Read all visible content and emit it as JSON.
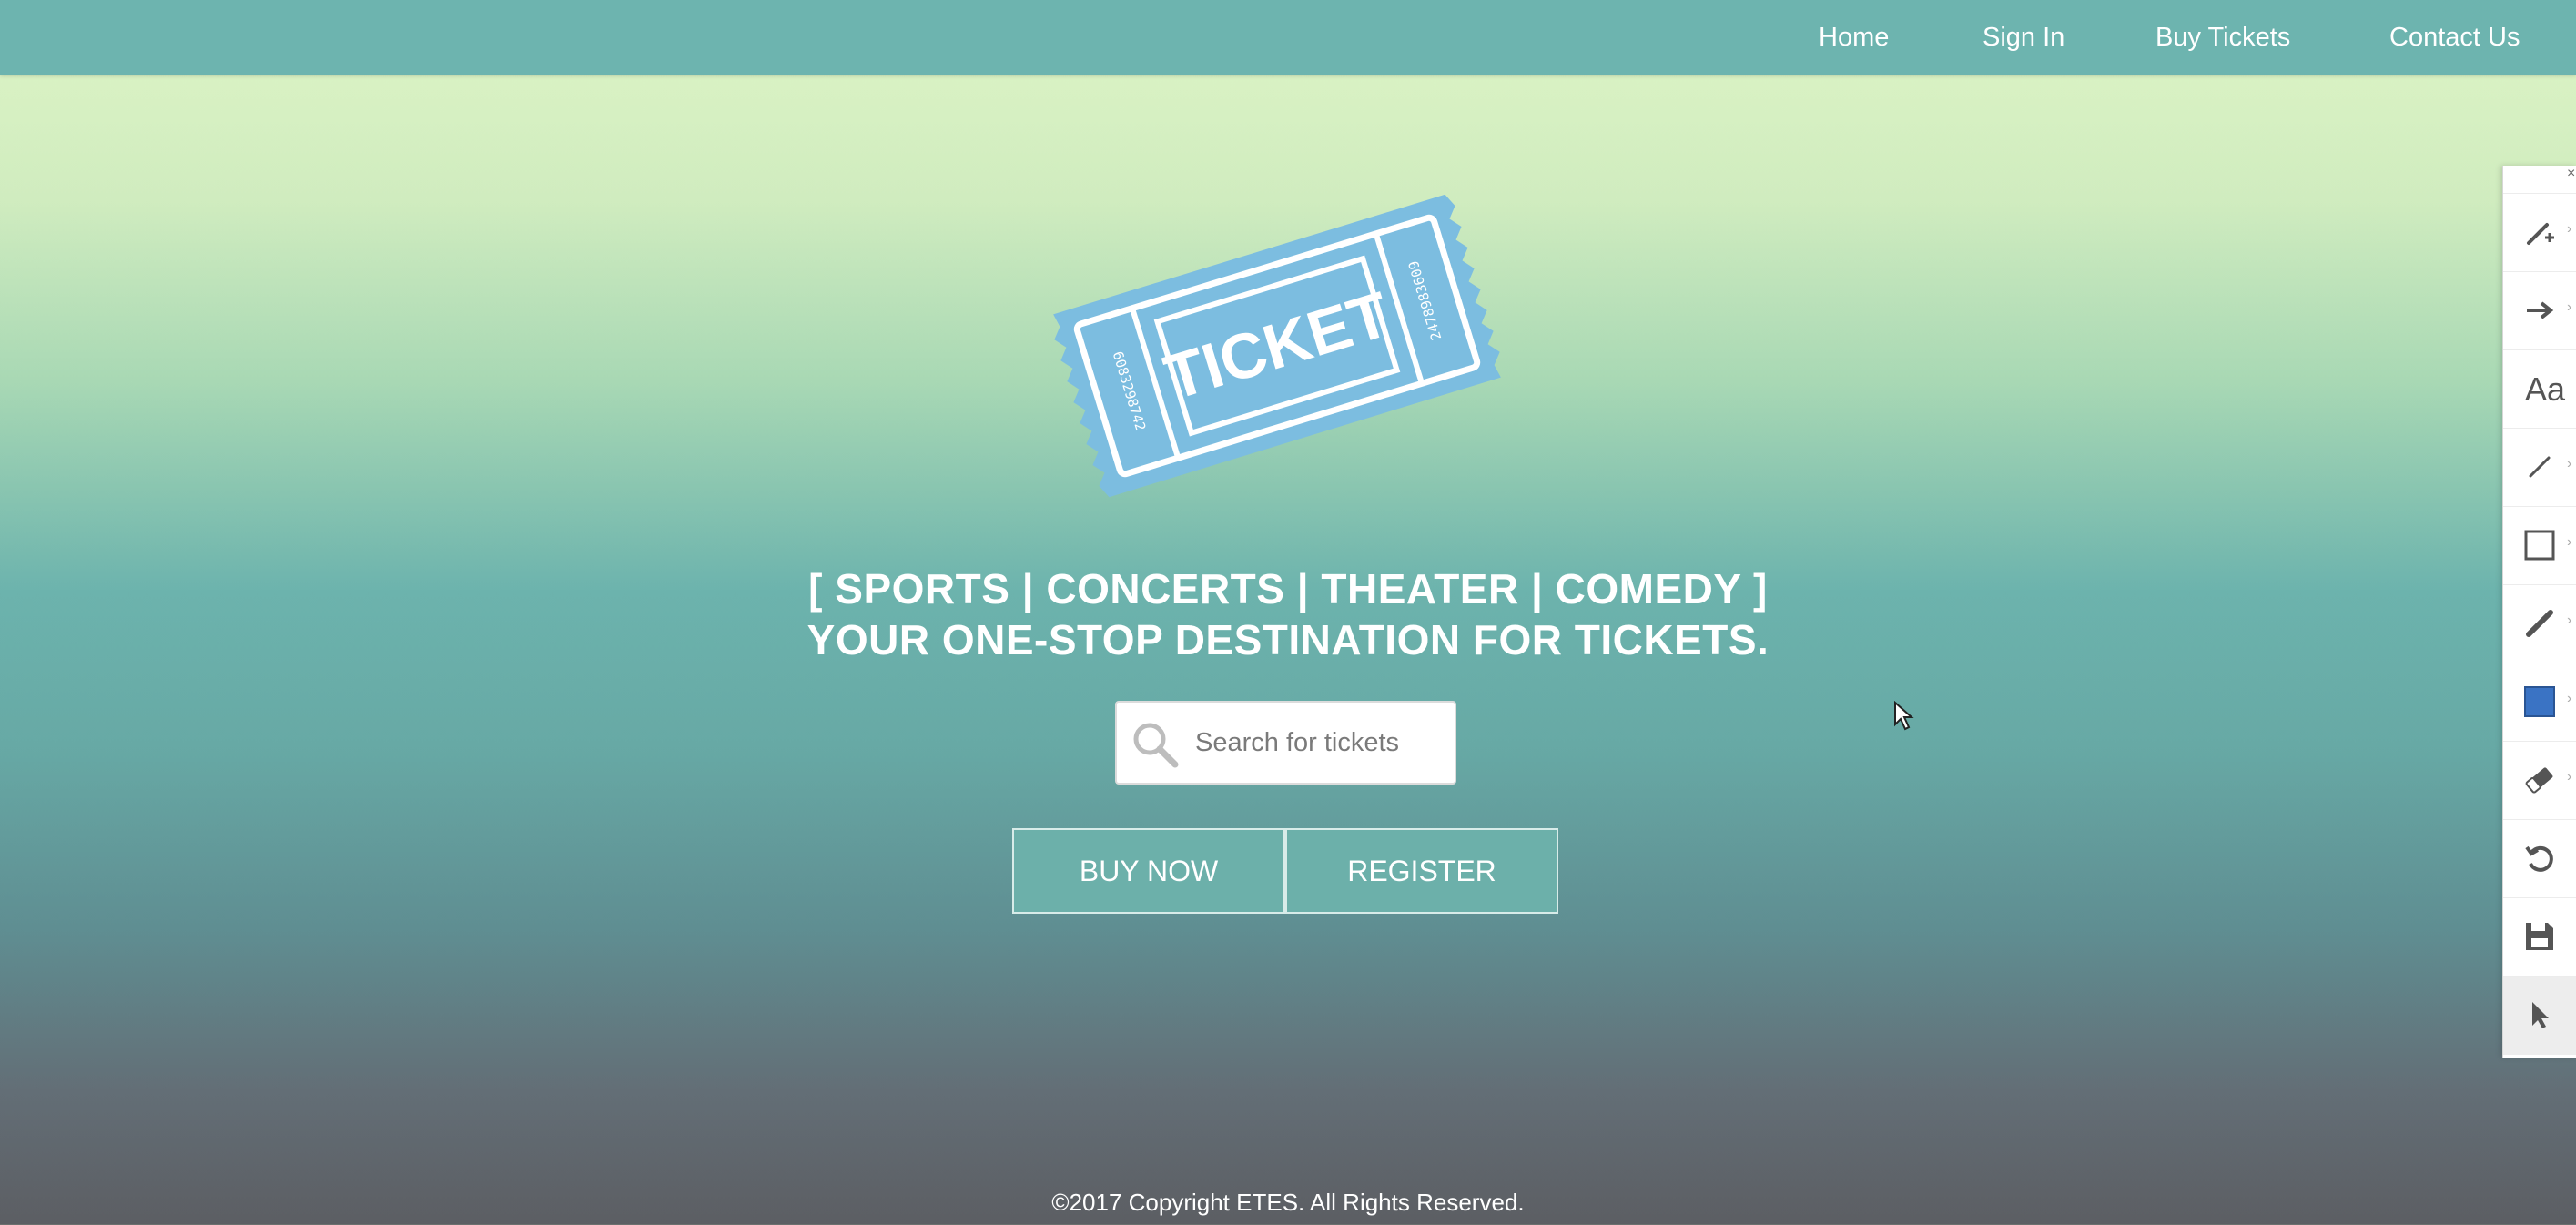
{
  "nav": {
    "items": [
      {
        "label": "Home"
      },
      {
        "label": "Sign In"
      },
      {
        "label": "Buy Tickets"
      },
      {
        "label": "Contact Us"
      }
    ]
  },
  "hero": {
    "logo": {
      "word": "TICKET",
      "serial_left": "6083298742",
      "serial_right": "2478983609"
    },
    "tagline_line1": "[ SPORTS | CONCERTS | THEATER | COMEDY ]",
    "tagline_line2": "YOUR ONE-STOP DESTINATION FOR TICKETS.",
    "search": {
      "placeholder": "Search for tickets",
      "value": ""
    },
    "buttons": {
      "buy_now": "BUY NOW",
      "register": "REGISTER"
    }
  },
  "footer": {
    "copyright": "©2017 Copyright ETES. All Rights Reserved."
  },
  "toolbar": {
    "close_glyph": "×",
    "text_tool_label": "Aa",
    "tools": [
      {
        "icon": "pen-add-icon"
      },
      {
        "icon": "arrow-right-icon"
      },
      {
        "icon": "text-icon"
      },
      {
        "icon": "line-icon"
      },
      {
        "icon": "rectangle-icon"
      },
      {
        "icon": "brush-icon"
      },
      {
        "icon": "color-swatch-icon"
      },
      {
        "icon": "eraser-icon"
      },
      {
        "icon": "undo-icon"
      },
      {
        "icon": "save-icon"
      },
      {
        "icon": "select-pointer-icon"
      }
    ]
  },
  "colors": {
    "nav_bg": "#6db4af",
    "button_bg": "#6cb0aa",
    "ticket_blue": "#7cbde0",
    "swatch_blue": "#3a73c4"
  }
}
